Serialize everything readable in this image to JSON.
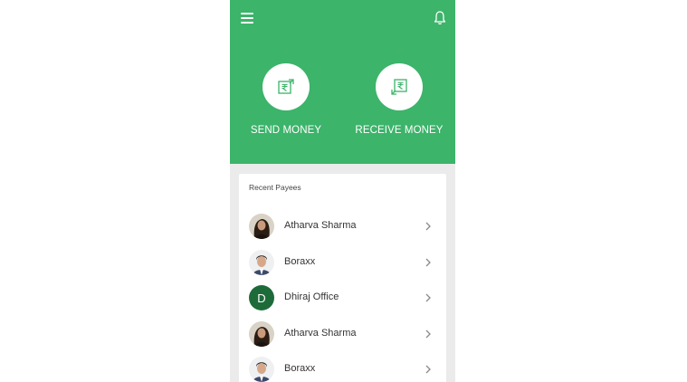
{
  "header": {
    "actions": [
      {
        "label": "SEND MONEY",
        "icon": "rupee-send-icon"
      },
      {
        "label": "RECEIVE MONEY",
        "icon": "rupee-receive-icon"
      }
    ]
  },
  "recent_payees": {
    "title": "Recent Payees",
    "items": [
      {
        "name": "Atharva Sharma",
        "avatar": "photo-female"
      },
      {
        "name": "Boraxx",
        "avatar": "photo-male"
      },
      {
        "name": "Dhiraj Office",
        "avatar_letter": "D"
      },
      {
        "name": "Atharva Sharma",
        "avatar": "photo-female"
      },
      {
        "name": "Boraxx",
        "avatar": "photo-male"
      }
    ]
  },
  "colors": {
    "brand_green": "#3cb46a",
    "avatar_green": "#1e6b3a"
  }
}
